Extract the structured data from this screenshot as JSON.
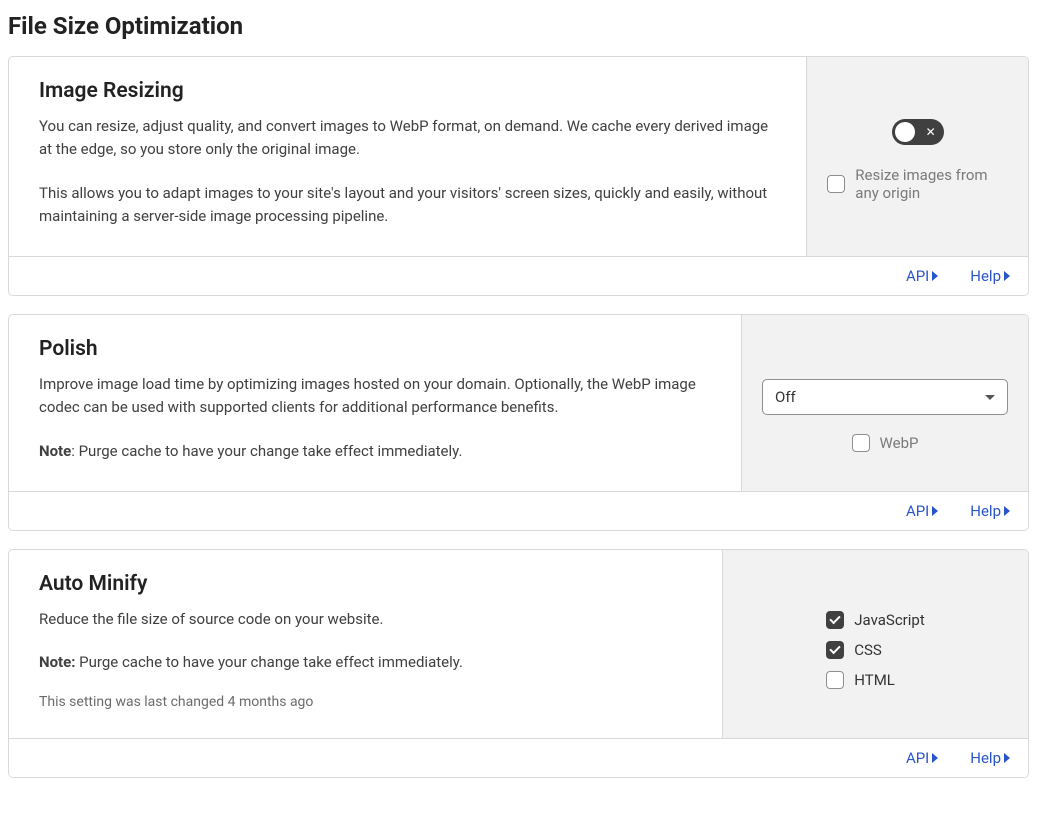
{
  "page_title": "File Size Optimization",
  "footer": {
    "api": "API",
    "help": "Help"
  },
  "sections": {
    "image_resizing": {
      "title": "Image Resizing",
      "desc1": "You can resize, adjust quality, and convert images to WebP format, on demand. We cache every derived image at the edge, so you store only the original image.",
      "desc2": "This allows you to adapt images to your site's layout and your visitors' screen sizes, quickly and easily, without maintaining a server-side image processing pipeline.",
      "toggle_on": false,
      "origin_label": "Resize images from any origin",
      "origin_checked": false
    },
    "polish": {
      "title": "Polish",
      "desc": "Improve image load time by optimizing images hosted on your domain. Optionally, the WebP image codec can be used with supported clients for additional performance benefits.",
      "note_label": "Note",
      "note_text": ": Purge cache to have your change take effect immediately.",
      "select_value": "Off",
      "webp_label": "WebP",
      "webp_checked": false
    },
    "auto_minify": {
      "title": "Auto Minify",
      "desc": "Reduce the file size of source code on your website.",
      "note_label": "Note:",
      "note_text": " Purge cache to have your change take effect immediately.",
      "meta": "This setting was last changed 4 months ago",
      "options": [
        {
          "label": "JavaScript",
          "checked": true
        },
        {
          "label": "CSS",
          "checked": true
        },
        {
          "label": "HTML",
          "checked": false
        }
      ]
    }
  }
}
